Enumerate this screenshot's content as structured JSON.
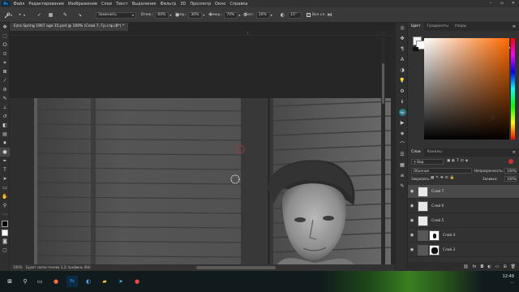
{
  "menu": {
    "logo": "Ps",
    "items": [
      "Файл",
      "Редактирование",
      "Изображение",
      "Слои",
      "Текст",
      "Выделение",
      "Фильтр",
      "3D",
      "Просмотр",
      "Окно",
      "Справка"
    ],
    "window_buttons": [
      "–",
      "▫",
      "✕"
    ]
  },
  "options": {
    "mode_value": "Заменить",
    "flow_label": "Втяж.:",
    "flow_value": "60%",
    "opacity_label": "Запр.:",
    "opacity_value": "30%",
    "pressure_label": "Смеш.:",
    "pressure_value": "70%",
    "amount_label": "Кол.:",
    "amount_value": "30%",
    "angle_value": "15°",
    "sample_all_label": "Все сл."
  },
  "document": {
    "tab_title": "Ezra Spring 1907 age 15.psd @ 100% (Слой 7, Гр.слр./8*) *",
    "status_zoom": "100%",
    "status_text": "Будет свези генева 3,2/ профиль (8b)"
  },
  "colors": {
    "hue_accent": "#ff6a00",
    "selected_row": "#4a4a4a",
    "panel_bg": "#323232"
  },
  "color_panel": {
    "tabs": [
      "Цвет",
      "Градиенты",
      "Узоры"
    ]
  },
  "layers_panel": {
    "tabs": [
      "Слои",
      "Каналы"
    ],
    "search_placeholder": "Вид",
    "blend_mode": "Обычные",
    "opacity_label": "Непрозрачность:",
    "opacity_value": "100%",
    "lock_label": "Закрепить:",
    "fill_label": "Заливка:",
    "fill_value": "100%",
    "layers": [
      {
        "name": "Слой 7",
        "selected": true
      },
      {
        "name": "Слой 6",
        "selected": false
      },
      {
        "name": "Слой 5",
        "selected": false
      },
      {
        "name": "Слой 4",
        "selected": false
      },
      {
        "name": "Слой 3",
        "selected": false
      }
    ]
  },
  "taskbar": {
    "time": "12:49",
    "date": "..."
  }
}
